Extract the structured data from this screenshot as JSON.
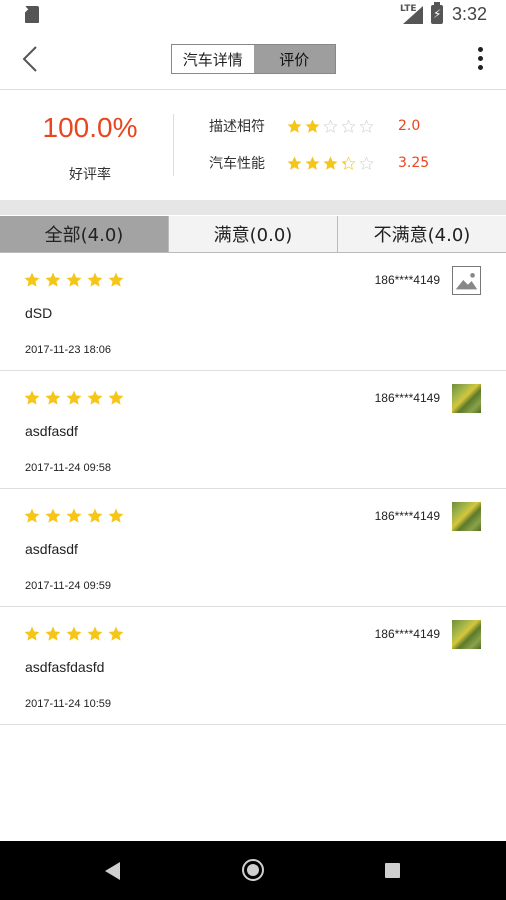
{
  "status_bar": {
    "time": "3:32",
    "network": "LTE",
    "icons": [
      "sd-card-icon",
      "signal-icon",
      "battery-charging-icon"
    ]
  },
  "header": {
    "back_icon": "chevron-left-icon",
    "tabs": [
      {
        "label": "汽车详情",
        "active": false
      },
      {
        "label": "评价",
        "active": true
      }
    ],
    "menu_icon": "more-vertical-icon"
  },
  "summary": {
    "good_rate": "100.0%",
    "good_rate_label": "好评率",
    "metrics": [
      {
        "label": "描述相符",
        "rating": 2.0,
        "value": "2.0"
      },
      {
        "label": "汽车性能",
        "rating": 3.25,
        "value": "3.25"
      }
    ]
  },
  "filter_tabs": [
    {
      "label": "全部(4.0)",
      "active": true
    },
    {
      "label": "满意(0.0)",
      "active": false
    },
    {
      "label": "不满意(4.0)",
      "active": false
    }
  ],
  "reviews": [
    {
      "stars": 5,
      "user": "186****4149",
      "text": "dSD",
      "time": "2017-11-23 18:06",
      "avatar": "image-placeholder-icon"
    },
    {
      "stars": 5,
      "user": "186****4149",
      "text": "asdfasdf",
      "time": "2017-11-24 09:58",
      "avatar": "photo-thumbnail"
    },
    {
      "stars": 5,
      "user": "186****4149",
      "text": "asdfasdf",
      "time": "2017-11-24 09:59",
      "avatar": "photo-thumbnail"
    },
    {
      "stars": 5,
      "user": "186****4149",
      "text": "asdfasfdasfd",
      "time": "2017-11-24 10:59",
      "avatar": "photo-thumbnail"
    }
  ],
  "colors": {
    "accent": "#e8461f",
    "star": "#f5c518",
    "star_empty": "#d0d0d0",
    "active_tab": "#9e9e9e"
  },
  "nav_bar": {
    "icons": [
      "back-triangle-icon",
      "home-circle-icon",
      "recents-square-icon"
    ]
  }
}
